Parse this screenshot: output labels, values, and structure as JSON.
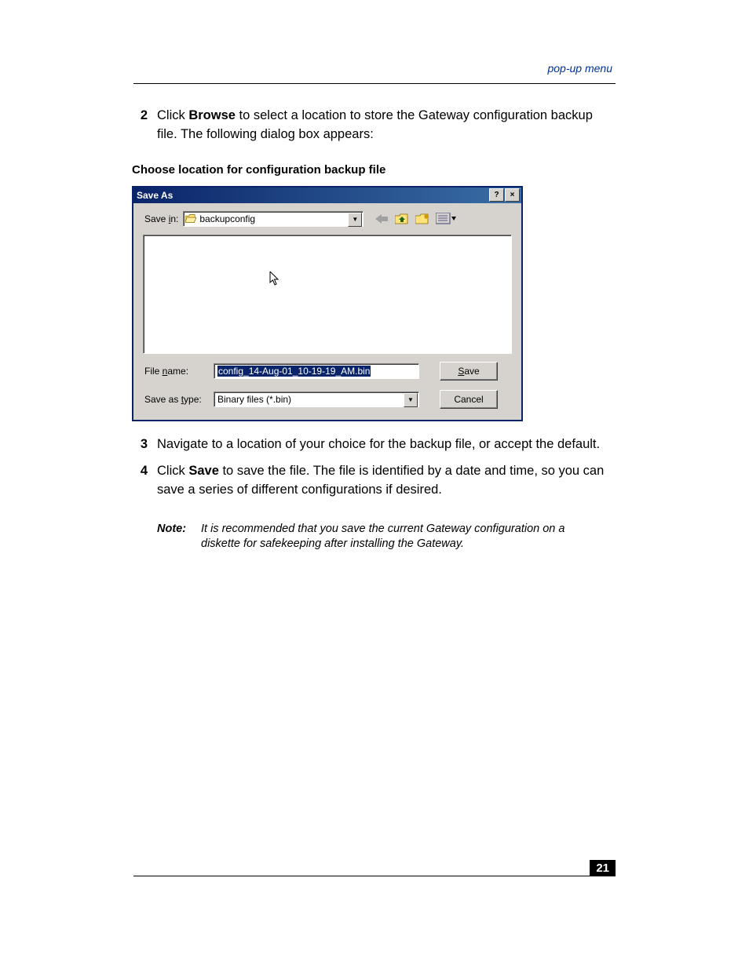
{
  "header": {
    "breadcrumb": "pop-up menu"
  },
  "steps": {
    "s2": {
      "num": "2",
      "pre": "Click ",
      "bold": "Browse",
      "post": " to select a location to store the Gateway configuration backup file. The following dialog box appears:"
    },
    "caption": "Choose location for configuration backup file",
    "s3": {
      "num": "3",
      "text": "Navigate to a location of your choice for the backup file, or accept the default."
    },
    "s4": {
      "num": "4",
      "pre": "Click ",
      "bold": "Save",
      "post": " to save the file. The file is identified by a date and time, so you can save a series of different configurations if desired."
    }
  },
  "dialog": {
    "title": "Save As",
    "help_btn": "?",
    "close_btn": "×",
    "savein_label": "Save in:",
    "savein_value": "backupconfig",
    "filename_label": "File name:",
    "filename_value": "config_14-Aug-01_10-19-19_AM.bin",
    "type_label": "Save as type:",
    "type_value": "Binary files (*.bin)",
    "save_btn_u": "S",
    "save_btn_rest": "ave",
    "cancel_btn": "Cancel"
  },
  "note": {
    "label": "Note:",
    "text": "It is recommended that you save the current Gateway configuration on a diskette for safekeeping after installing the Gateway."
  },
  "footer": {
    "page": "21"
  }
}
